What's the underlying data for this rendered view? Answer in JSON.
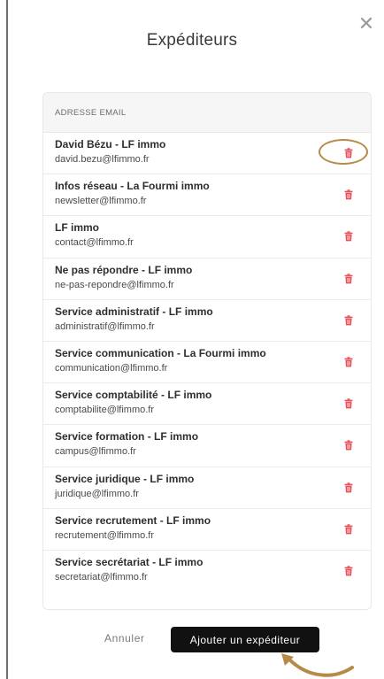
{
  "dialog": {
    "title": "Expéditeurs",
    "close_label": "✕",
    "column_header": "ADRESSE EMAIL",
    "cancel_label": "Annuler",
    "add_label": "Ajouter un expéditeur"
  },
  "senders": [
    {
      "name": "David Bézu - LF immo",
      "email": "david.bezu@lfimmo.fr"
    },
    {
      "name": "Infos réseau - La Fourmi immo",
      "email": "newsletter@lfimmo.fr"
    },
    {
      "name": "LF immo",
      "email": "contact@lfimmo.fr"
    },
    {
      "name": "Ne pas répondre - LF immo",
      "email": "ne-pas-repondre@lfimmo.fr"
    },
    {
      "name": "Service administratif - LF immo",
      "email": "administratif@lfimmo.fr"
    },
    {
      "name": "Service communication - La Fourmi immo",
      "email": "communication@lfimmo.fr"
    },
    {
      "name": "Service comptabilité - LF immo",
      "email": "comptabilite@lfimmo.fr"
    },
    {
      "name": "Service formation - LF immo",
      "email": "campus@lfimmo.fr"
    },
    {
      "name": "Service juridique - LF immo",
      "email": "juridique@lfimmo.fr"
    },
    {
      "name": "Service recrutement - LF immo",
      "email": "recrutement@lfimmo.fr"
    },
    {
      "name": "Service secrétariat - LF immo",
      "email": "secretariat@lfimmo.fr"
    }
  ],
  "icons": {
    "delete": "trash-icon",
    "close": "close-icon"
  },
  "colors": {
    "trash": "#e8505b",
    "annotation": "#b68a47",
    "button": "#111111"
  }
}
